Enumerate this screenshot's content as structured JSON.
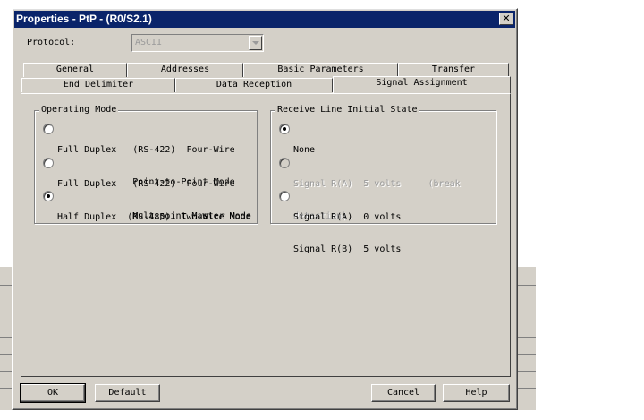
{
  "window": {
    "title": "Properties - PtP - (R0/S2.1)"
  },
  "protocol": {
    "label": "Protocol:",
    "value": "ASCII"
  },
  "tabs_row_back": [
    "General",
    "Addresses",
    "Basic Parameters",
    "Transfer"
  ],
  "tabs_row_front": [
    "End Delimiter",
    "Data Reception",
    "Signal Assignment"
  ],
  "active_tab": "Signal Assignment",
  "operating_mode": {
    "legend": "Operating Mode",
    "options": [
      {
        "lines": [
          "Full Duplex   (RS-422)  Four-Wire",
          "              Point-to-Point Mode"
        ],
        "checked": false,
        "disabled": false
      },
      {
        "lines": [
          "Full Duplex   (RS-422)  Four-Wire",
          "              Multipoint Master Mode"
        ],
        "checked": false,
        "disabled": false
      },
      {
        "lines": [
          "Half Duplex  (RS-485)  Two-Wire Mode"
        ],
        "checked": true,
        "disabled": false
      }
    ]
  },
  "receive_line": {
    "legend": "Receive Line Initial State",
    "options": [
      {
        "lines": [
          "None"
        ],
        "checked": true,
        "disabled": false
      },
      {
        "lines": [
          "Signal R(A)  5 volts     (break",
          "detection)."
        ],
        "checked": false,
        "disabled": true
      },
      {
        "lines": [
          "Signal R(A)  0 volts",
          "Signal R(B)  5 volts"
        ],
        "checked": false,
        "disabled": false
      }
    ]
  },
  "buttons": {
    "ok": "OK",
    "default": "Default",
    "cancel": "Cancel",
    "help": "Help"
  },
  "close_glyph": "✕"
}
